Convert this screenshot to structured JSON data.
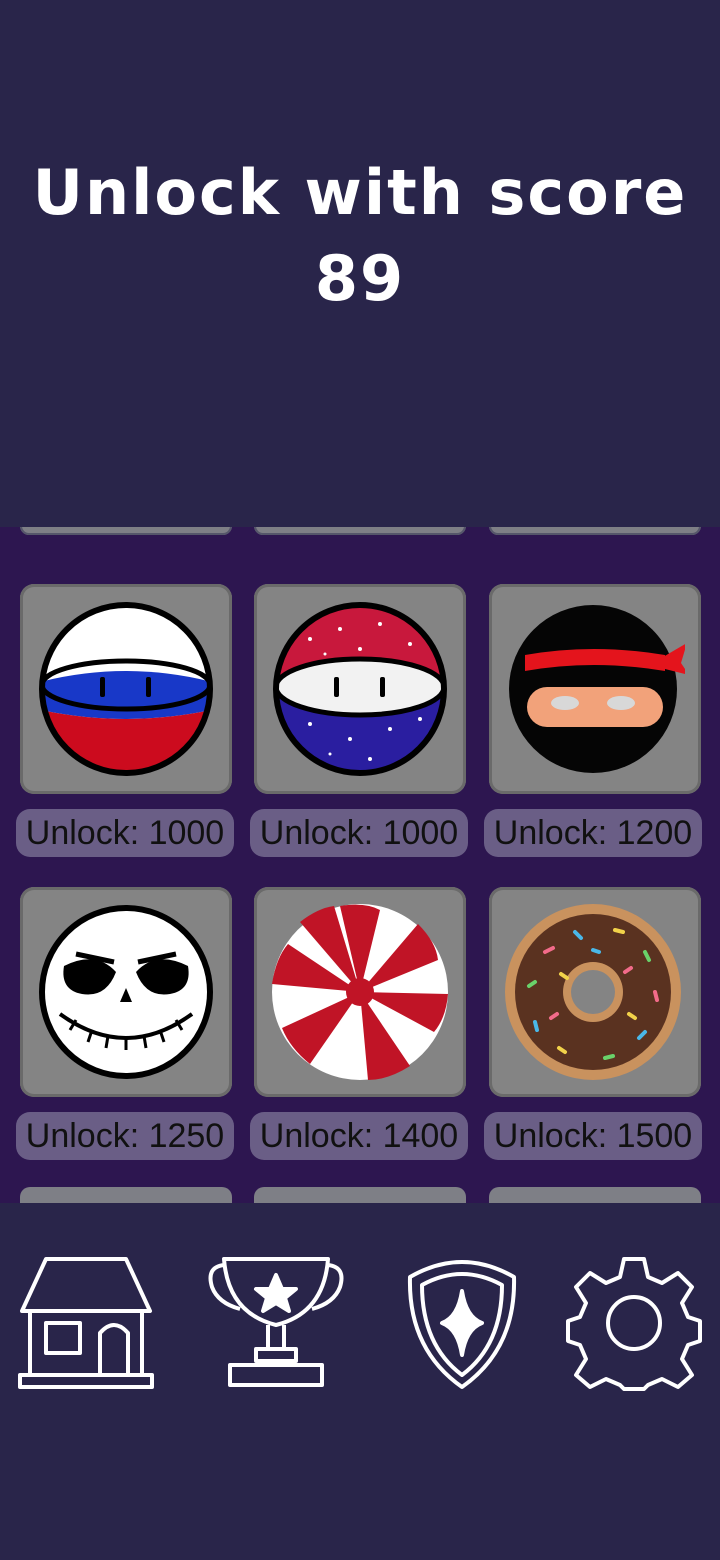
{
  "header": {
    "title": "Unlock with score",
    "score": "89"
  },
  "skins": [
    {
      "name": "russia-ball",
      "label": "Unlock: 1000"
    },
    {
      "name": "usa-ball",
      "label": "Unlock: 1000"
    },
    {
      "name": "ninja-ball",
      "label": "Unlock: 1200"
    },
    {
      "name": "skull-ball",
      "label": "Unlock: 1250"
    },
    {
      "name": "peppermint-ball",
      "label": "Unlock: 1400"
    },
    {
      "name": "donut-ball",
      "label": "Unlock: 1500"
    }
  ],
  "nav": {
    "items": [
      {
        "icon": "home-icon"
      },
      {
        "icon": "trophy-icon"
      },
      {
        "icon": "shield-icon"
      },
      {
        "icon": "gear-icon"
      }
    ]
  }
}
